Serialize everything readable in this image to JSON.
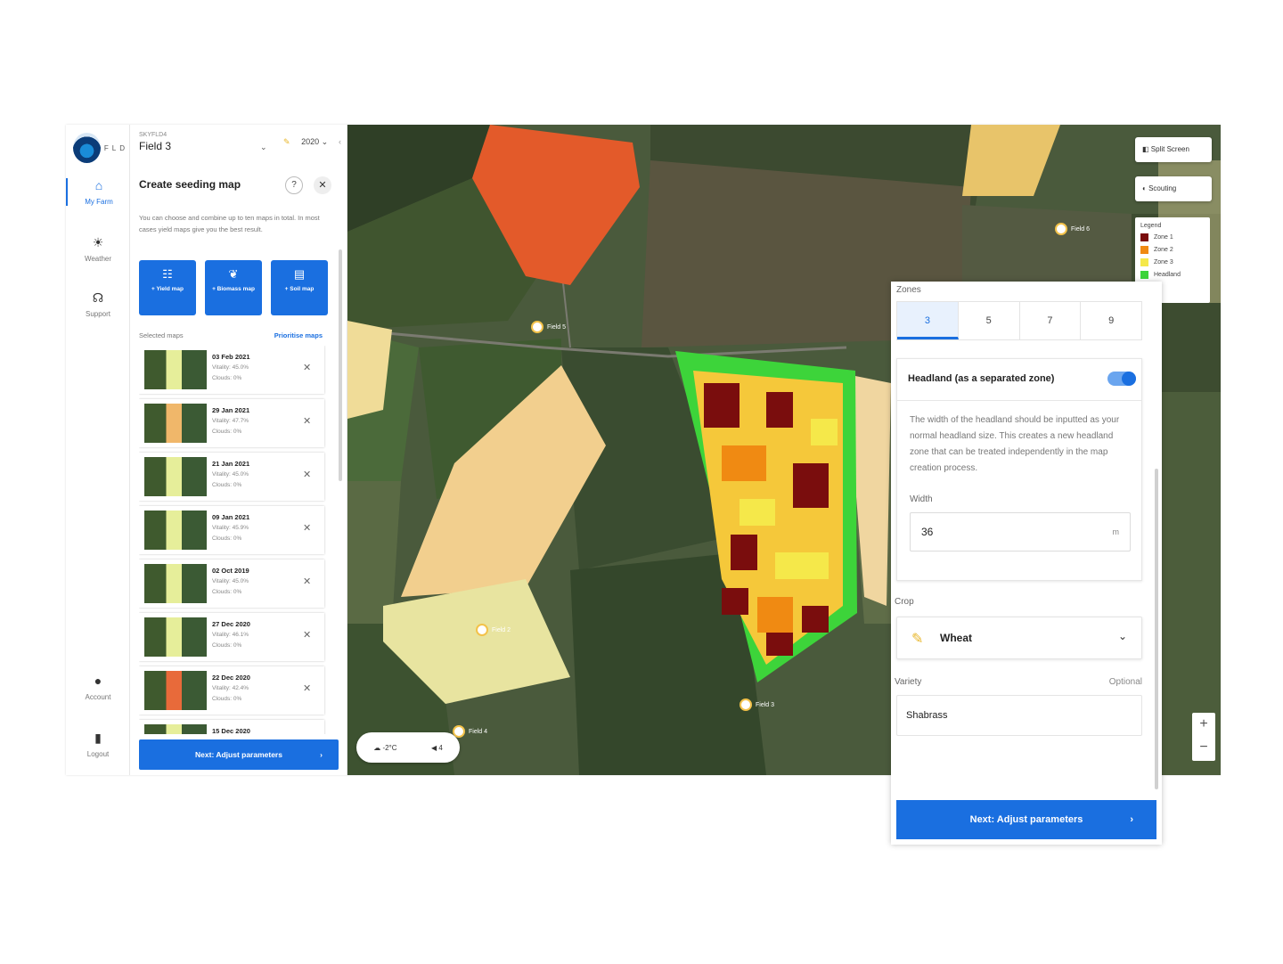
{
  "rail": {
    "logo_text": "FLD",
    "items": [
      {
        "label": "My Farm",
        "icon": "home-icon"
      },
      {
        "label": "Weather",
        "icon": "sun-icon"
      },
      {
        "label": "Support",
        "icon": "headset-icon"
      }
    ],
    "bottom": [
      {
        "label": "Account",
        "icon": "user-icon"
      },
      {
        "label": "Logout",
        "icon": "logout-icon"
      }
    ]
  },
  "panel": {
    "field_label": "SKYFLD4",
    "field_value": "Field 3",
    "season": "2020",
    "title": "Create seeding map",
    "description": "You can choose and combine up to ten maps in total. In most cases yield maps give you the best result.",
    "add_buttons": [
      "+ Yield map",
      "+ Biomass map",
      "+ Soil map"
    ],
    "selected_label": "Selected maps",
    "prioritise_label": "Prioritise maps",
    "maps": [
      {
        "date": "03 Feb 2021",
        "vitality": "Vitality: 45.0%",
        "clouds": "Clouds: 0%",
        "thumb": "y"
      },
      {
        "date": "29 Jan 2021",
        "vitality": "Vitality: 47.7%",
        "clouds": "Clouds: 0%",
        "thumb": "o"
      },
      {
        "date": "21 Jan 2021",
        "vitality": "Vitality: 45.0%",
        "clouds": "Clouds: 0%",
        "thumb": "y"
      },
      {
        "date": "09 Jan 2021",
        "vitality": "Vitality: 45.9%",
        "clouds": "Clouds: 0%",
        "thumb": "y"
      },
      {
        "date": "02 Oct 2019",
        "vitality": "Vitality: 45.0%",
        "clouds": "Clouds: 0%",
        "thumb": "y"
      },
      {
        "date": "27 Dec 2020",
        "vitality": "Vitality: 46.1%",
        "clouds": "Clouds: 0%",
        "thumb": "y"
      },
      {
        "date": "22 Dec 2020",
        "vitality": "Vitality: 42.4%",
        "clouds": "Clouds: 0%",
        "thumb": "r"
      },
      {
        "date": "15 Dec 2020",
        "vitality": "",
        "clouds": "",
        "thumb": "y"
      }
    ],
    "next_label": "Next: Adjust parameters"
  },
  "map": {
    "split_screen": "Split Screen",
    "scouting": "Scouting",
    "legend_title": "Legend",
    "legend": [
      {
        "label": "Zone 1",
        "color": "#7a0d0d"
      },
      {
        "label": "Zone 2",
        "color": "#f08a12"
      },
      {
        "label": "Zone 3",
        "color": "#f5e84a"
      },
      {
        "label": "Headland",
        "color": "#3dd43a"
      }
    ],
    "field_labels": [
      "Field 6",
      "Field 5",
      "Field 2",
      "Field 3",
      "Field 4"
    ],
    "weather_temp": "-2°C",
    "weather_wind": "4"
  },
  "overlay": {
    "zones_label": "Zones",
    "zone_options": [
      "3",
      "5",
      "7",
      "9"
    ],
    "zone_selected": "3",
    "headland_label": "Headland (as a separated zone)",
    "headland_desc": "The width of the headland should be inputted as your normal headland size. This creates a new headland zone that can be treated independently in the map creation process.",
    "width_label": "Width",
    "width_value": "36",
    "width_unit": "m",
    "crop_label": "Crop",
    "crop_value": "Wheat",
    "variety_label": "Variety",
    "variety_optional": "Optional",
    "variety_value": "Shabrass",
    "next_label": "Next: Adjust parameters"
  }
}
